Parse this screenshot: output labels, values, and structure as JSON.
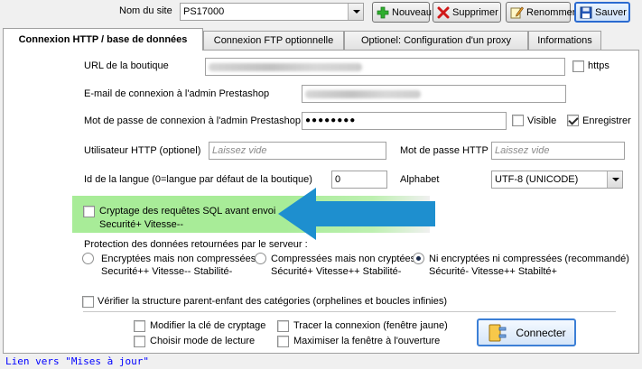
{
  "header": {
    "site_label": "Nom du site",
    "site_value": "PS17000",
    "new_label": "Nouveau",
    "delete_label": "Supprimer",
    "rename_label": "Renommer",
    "save_label": "Sauver"
  },
  "tabs": [
    {
      "label": "Connexion HTTP / base de données"
    },
    {
      "label": "Connexion FTP optionnelle"
    },
    {
      "label": "Optionel: Configuration d'un proxy"
    },
    {
      "label": "Informations"
    }
  ],
  "form": {
    "url_label": "URL de la boutique",
    "https_label": "https",
    "email_label": "E-mail de connexion à l'admin Prestashop",
    "password_label": "Mot de passe de connexion à l'admin Prestashop",
    "password_value": "●●●●●●●●",
    "visible_label": "Visible",
    "register_label": "Enregistrer",
    "http_user_label": "Utilisateur HTTP (optionel)",
    "http_user_placeholder": "Laissez vide",
    "http_pass_label": "Mot de passe HTTP",
    "http_pass_placeholder": "Laissez vide",
    "lang_label": "Id de la langue (0=langue par défaut de la boutique)",
    "lang_value": "0",
    "alphabet_label": "Alphabet",
    "alphabet_value": "UTF-8 (UNICODE)",
    "sql_encrypt_label": "Cryptage des requêtes SQL avant envoi",
    "sql_encrypt_sub": "Securité+ Vitesse--"
  },
  "protection": {
    "title": "Protection des données retournées par le serveur :",
    "options": [
      {
        "label": "Encryptées mais non compressées",
        "sub": "Securité++ Vitesse-- Stabilité-",
        "selected": false
      },
      {
        "label": "Compressées mais non cryptées",
        "sub": "Sécurité+ Vitesse++ Stabilité-",
        "selected": false
      },
      {
        "label": "Ni encryptées ni compressées (recommandé)",
        "sub": "Sécurité- Vitesse++ Stabilté+",
        "selected": true
      }
    ]
  },
  "verify_label": "Vérifier la structure parent-enfant des catégories (orphelines et boucles infinies)",
  "bottom": {
    "modify_key_label": "Modifier la clé de cryptage",
    "read_mode_label": "Choisir mode de lecture",
    "trace_label": "Tracer la connexion (fenêtre jaune)",
    "maximize_label": "Maximiser la fenêtre à l'ouverture",
    "connect_label": "Connecter"
  },
  "footer_link": "Lien vers \"Mises à jour\"",
  "colors": {
    "highlight": "#a8ec98",
    "arrow": "#1e8fcf",
    "link": "#0000ff"
  }
}
